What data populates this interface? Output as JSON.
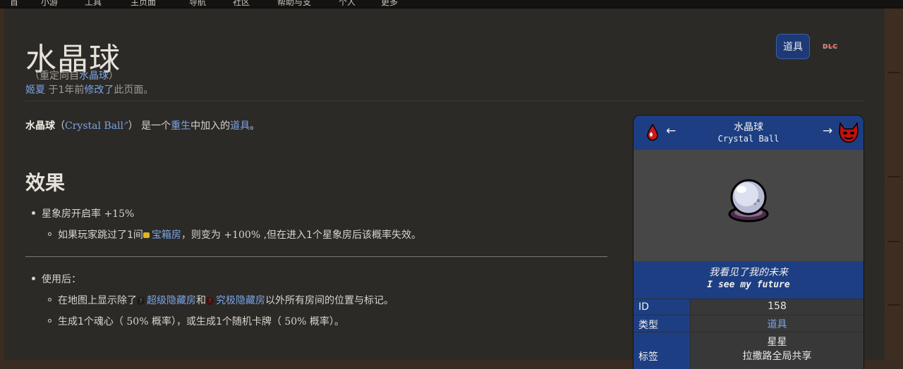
{
  "topbar": {
    "items": [
      "首",
      "小游",
      "工具",
      "主页面",
      "导航",
      "社区",
      "帮助与支",
      "个人",
      "更多"
    ]
  },
  "page": {
    "title": "水晶球",
    "redirect_prefix": "（重定向自",
    "redirect_link": "水晶球",
    "redirect_suffix": "）",
    "editor": "姬夏",
    "edit_middle": " 于1年前",
    "edit_link": "修改了",
    "edit_suffix": "此页面。",
    "badge_label": "道具",
    "dlc_label": "DLC"
  },
  "intro": {
    "bold": "水晶球",
    "paren_open": "（",
    "en_name": "Crystal Ball",
    "paren_close": "）",
    "text1": " 是一个",
    "link1": "重生",
    "text2": "中加入的",
    "link2": "道具",
    "text3": "。"
  },
  "effects": {
    "heading": "效果",
    "item1": {
      "prefix": "星象房开启率",
      "value": "+15%"
    },
    "item1_sub": {
      "prefix": "如果玩家跳过了1间",
      "link": "宝箱房",
      "middle": "，则变为",
      "value": "+100%",
      "suffix": ",但在进入1个星象房后该概率失效。"
    },
    "item2": {
      "text": "使用后："
    },
    "item2_sub1": {
      "prefix": "在地图上显示除了",
      "link1": "超级隐藏房",
      "and": "和",
      "link2": "究极隐藏房",
      "suffix": "以外所有房间的位置与标记。"
    },
    "item2_sub2": {
      "p1": "生成1个魂心（",
      "v1": "50%",
      "p2": "概率），或生成1个随机卡牌（",
      "v2": "50%",
      "p3": "概率）。"
    }
  },
  "infobox": {
    "title": "水晶球",
    "subtitle": "Crystal Ball",
    "left_arrow": "←",
    "right_arrow": "→",
    "quote_cn": "我看见了我的未来",
    "quote_en": "I see my future",
    "rows": [
      {
        "key": "ID",
        "value": "158"
      },
      {
        "key": "类型",
        "value": "道具"
      },
      {
        "key": "标签",
        "value1": "星星",
        "value2": "拉撒路全局共享"
      }
    ]
  },
  "colors": {
    "link": "#7ba4e3",
    "infobox_blue": "#1d3e82",
    "background": "#2c2a27"
  }
}
